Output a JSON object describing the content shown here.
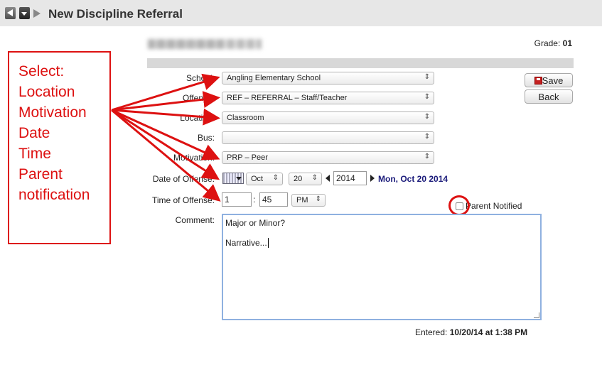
{
  "window": {
    "title": "New Discipline Referral"
  },
  "student": {
    "name": "▒▒▒▒▒▒▒ ▒▒▒▒▒",
    "grade_label": "Grade:",
    "grade_value": "01"
  },
  "form": {
    "school_label": "School:",
    "school_value": "Angling Elementary School",
    "offense_label": "Offense:",
    "offense_value": "REF – REFERRAL – Staff/Teacher",
    "location_label": "Location:",
    "location_value": "Classroom",
    "bus_label": "Bus:",
    "bus_value": "",
    "motivation_label": "Motivation:",
    "motivation_value": "PRP – Peer",
    "date_label": "Date of Offense:",
    "date_month": "Oct",
    "date_day": "20",
    "date_year": "2014",
    "date_display": "Mon, Oct 20 2014",
    "time_label": "Time of Offense:",
    "time_hour": "1",
    "time_minute": "45",
    "time_ampm": "PM",
    "parent_notified_label": "Parent Notified",
    "parent_notified_checked": false,
    "comment_label": "Comment:",
    "comment_line1": "Major or Minor?",
    "comment_line3": "Narrative...",
    "entered_label": "Entered:",
    "entered_value": "10/20/14 at 1:38 PM"
  },
  "buttons": {
    "save": "Save",
    "back": "Back"
  },
  "annotation": {
    "text": "Select:\nLocation\nMotivation\nDate\nTime\nParent\nnotification",
    "color": "#dd1111"
  }
}
